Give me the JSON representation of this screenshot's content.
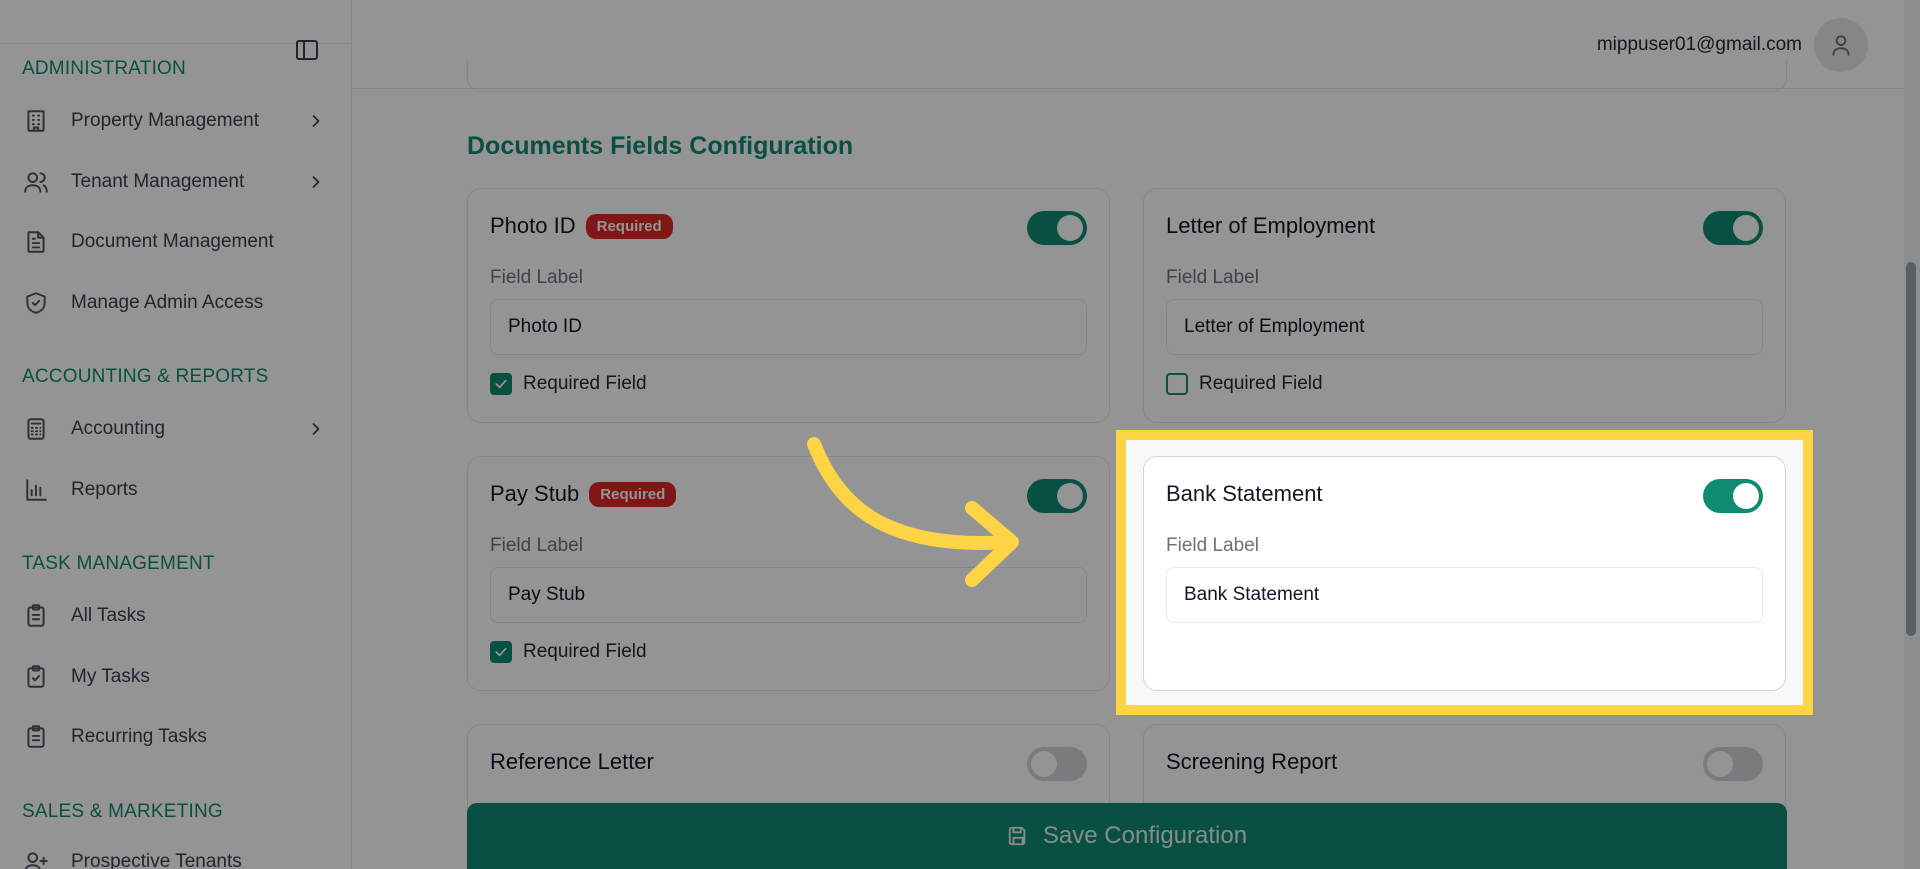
{
  "sidebar": {
    "sections": [
      {
        "title": "ADMINISTRATION"
      },
      {
        "title": "ACCOUNTING & REPORTS"
      },
      {
        "title": "TASK MANAGEMENT"
      },
      {
        "title": "SALES & MARKETING"
      }
    ],
    "items": [
      {
        "label": "Property Management",
        "icon": "building-icon",
        "has_chevron": true
      },
      {
        "label": "Tenant Management",
        "icon": "users-icon",
        "has_chevron": true
      },
      {
        "label": "Document Management",
        "icon": "document-icon",
        "has_chevron": false
      },
      {
        "label": "Manage Admin Access",
        "icon": "shield-check-icon",
        "has_chevron": false
      },
      {
        "label": "Accounting",
        "icon": "calculator-icon",
        "has_chevron": true
      },
      {
        "label": "Reports",
        "icon": "bar-chart-icon",
        "has_chevron": false
      },
      {
        "label": "All Tasks",
        "icon": "clipboard-list-icon",
        "has_chevron": false
      },
      {
        "label": "My Tasks",
        "icon": "clipboard-check-icon",
        "has_chevron": false
      },
      {
        "label": "Recurring Tasks",
        "icon": "clipboard-list-icon",
        "has_chevron": false
      },
      {
        "label": "Prospective Tenants",
        "icon": "user-plus-icon",
        "has_chevron": false
      }
    ]
  },
  "header": {
    "user_email": "mippuser01@gmail.com"
  },
  "main": {
    "title": "Documents Fields Configuration",
    "field_label_text": "Field Label",
    "required_field_text": "Required Field",
    "required_badge": "Required",
    "cards": [
      {
        "title": "Photo ID",
        "enabled": true,
        "required": true,
        "value": "Photo ID"
      },
      {
        "title": "Letter of Employment",
        "enabled": true,
        "required": false,
        "value": "Letter of Employment"
      },
      {
        "title": "Pay Stub",
        "enabled": true,
        "required": true,
        "value": "Pay Stub"
      },
      {
        "title": "Bank Statement",
        "enabled": true,
        "required": false,
        "value": "Bank Statement"
      },
      {
        "title": "Reference Letter",
        "enabled": false,
        "required": false,
        "value": ""
      },
      {
        "title": "Screening Report",
        "enabled": false,
        "required": false,
        "value": ""
      }
    ],
    "save_label": "Save Configuration"
  },
  "colors": {
    "accent": "#0f8a73",
    "required_badge": "#dc2626",
    "highlight": "#fdd444"
  }
}
